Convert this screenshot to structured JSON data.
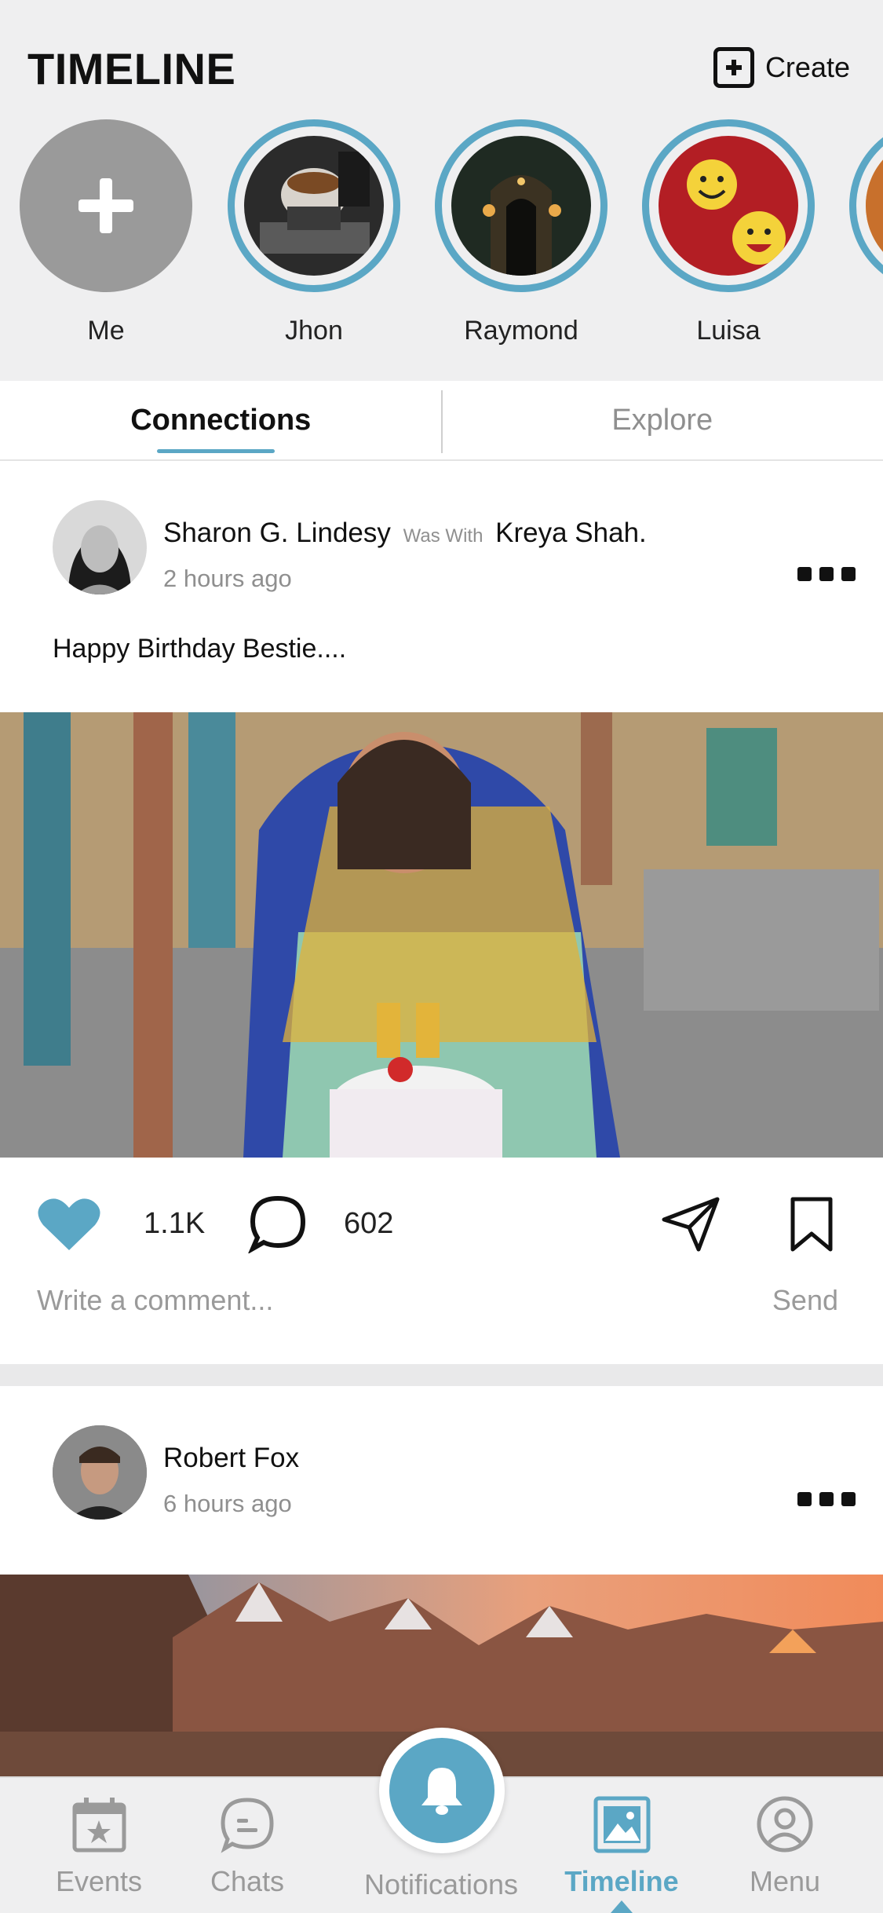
{
  "header": {
    "title": "TIMELINE",
    "create_label": "Create"
  },
  "stories": [
    {
      "name": "Me"
    },
    {
      "name": "Jhon"
    },
    {
      "name": "Raymond"
    },
    {
      "name": "Luisa"
    }
  ],
  "tabs": [
    {
      "label": "Connections",
      "active": true
    },
    {
      "label": "Explore",
      "active": false
    }
  ],
  "post1": {
    "author": "Sharon G. Lindesy",
    "was_with": "Was With",
    "with_person": "Kreya Shah.",
    "time": "2 hours ago",
    "caption": "Happy Birthday Bestie....",
    "likes": "1.1K",
    "comments": "602",
    "comment_placeholder": "Write a comment...",
    "send_label": "Send"
  },
  "post2": {
    "author": "Robert Fox",
    "time": "6 hours ago"
  },
  "bottom_nav": [
    {
      "label": "Events",
      "icon": "calendar-star-icon"
    },
    {
      "label": "Chats",
      "icon": "chat-bubble-icon"
    },
    {
      "label": "Notifications",
      "icon": "bell-icon"
    },
    {
      "label": "Timeline",
      "icon": "image-icon",
      "active": true
    },
    {
      "label": "Menu",
      "icon": "user-circle-icon"
    }
  ],
  "colors": {
    "accent": "#5ba7c5",
    "background": "#efeff0"
  }
}
